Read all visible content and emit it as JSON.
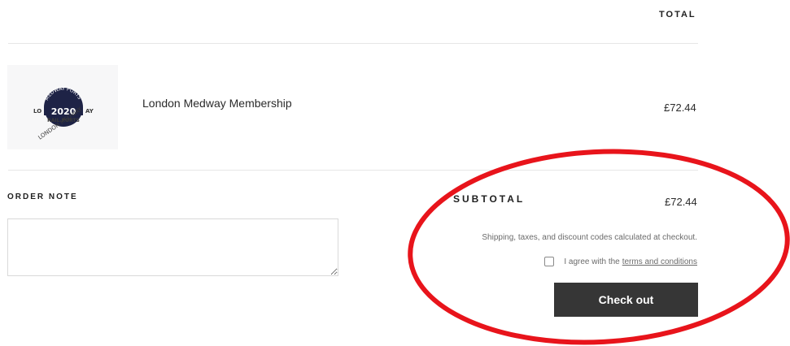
{
  "cart": {
    "total_header": "TOTAL",
    "items": [
      {
        "name": "London Medway Membership",
        "price": "£72.44",
        "thumbnail": {
          "arc_top": "MEDWAY PORTS",
          "year": "2020",
          "left_text": "LO",
          "right_text": "AY",
          "bottom_text": "RAIL PORTS",
          "diagonal_text": "LONDON MEDWAY",
          "colors": {
            "badge": "#1e2346",
            "text": "#3a3a3a"
          }
        }
      }
    ]
  },
  "order_note": {
    "label": "ORDER NOTE",
    "value": ""
  },
  "summary": {
    "subtotal_label": "SUBTOTAL",
    "subtotal_value": "£72.44",
    "shipping_note": "Shipping, taxes, and discount codes calculated at checkout.",
    "agree_prefix": "I agree with the",
    "terms_link": "terms and conditions",
    "agree_checked": false,
    "checkout_label": "Check out"
  },
  "annotation": {
    "color": "#e8141b",
    "shape": "ellipse-highlight"
  },
  "colors": {
    "button": "#363636",
    "divider": "#e6e6e6"
  }
}
